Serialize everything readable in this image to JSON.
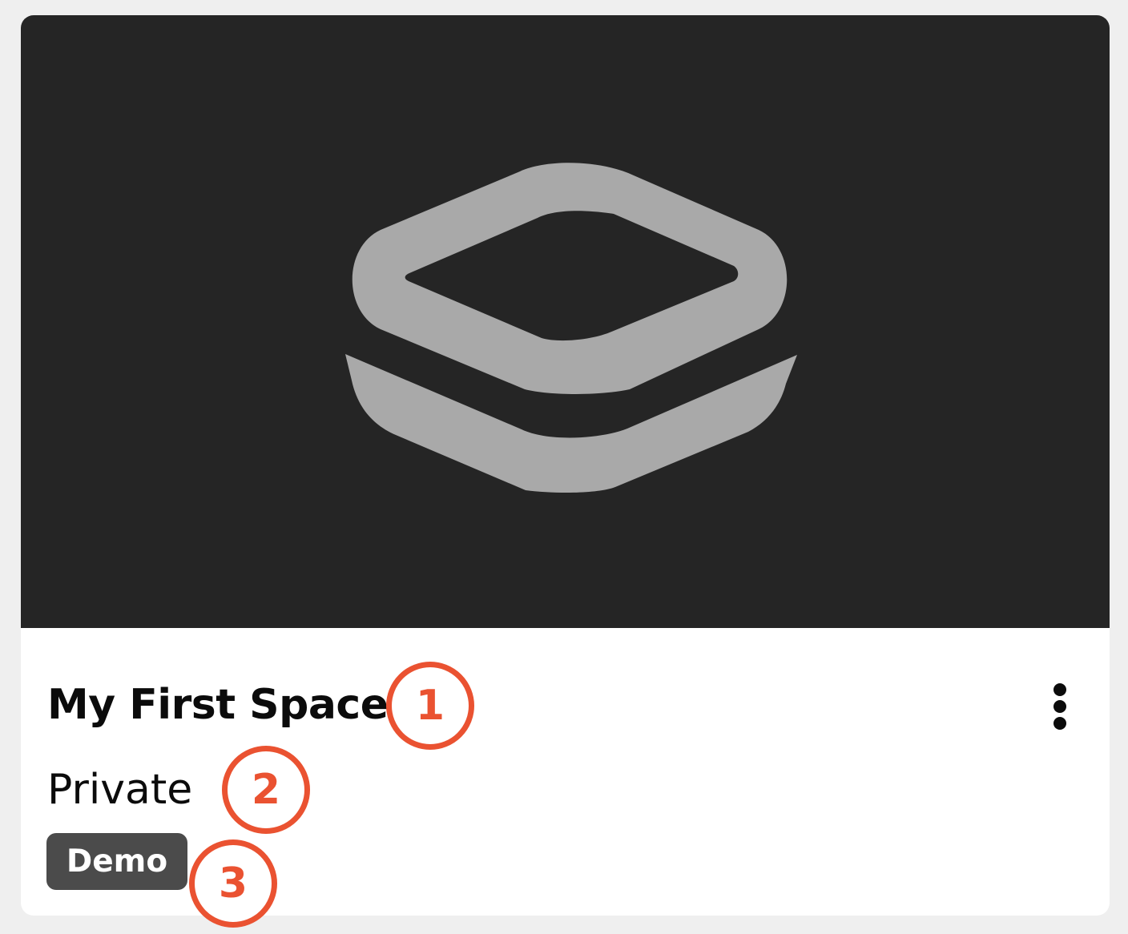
{
  "space": {
    "title": "My First Space",
    "visibility": "Private",
    "tag": "Demo"
  },
  "thumbnail": {
    "icon": "layered-square-logo-icon"
  },
  "menu": {
    "icon": "more-vertical-icon"
  },
  "annotations": [
    {
      "label": "1"
    },
    {
      "label": "2"
    },
    {
      "label": "3"
    }
  ],
  "colors": {
    "page_background": "#efefef",
    "card_background": "#ffffff",
    "thumbnail_background": "#252525",
    "logo": "#a9a9a9",
    "tag_background": "#4b4b4b",
    "callout": "#ea5231",
    "text": "#0b0b0b"
  }
}
